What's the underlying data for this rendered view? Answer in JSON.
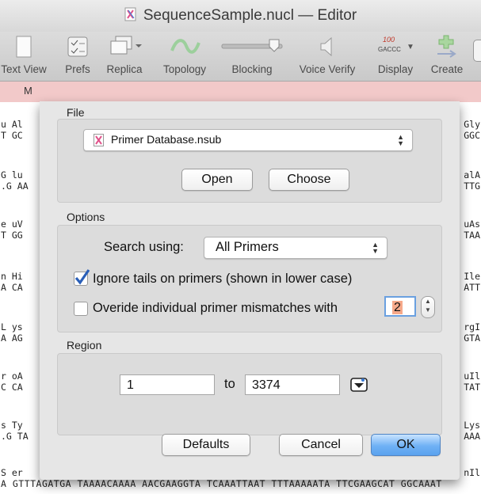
{
  "window": {
    "title": "SequenceSample.nucl — Editor"
  },
  "toolbar": {
    "items": [
      {
        "label": "Text View",
        "icon": "document-icon"
      },
      {
        "label": "Prefs",
        "icon": "checklist-icon"
      },
      {
        "label": "Replica",
        "icon": "windows-icon"
      },
      {
        "label": "Topology",
        "icon": "topology-icon"
      },
      {
        "label": "Blocking",
        "icon": "slider-icon"
      },
      {
        "label": "Voice Verify",
        "icon": "speaker-icon"
      },
      {
        "label": "Display",
        "icon": "display-icon",
        "badge_top": "100",
        "badge_bottom": "GACCC"
      },
      {
        "label": "Create",
        "icon": "create-icon"
      }
    ]
  },
  "tabstrip": {
    "first_tab": "M"
  },
  "sequence": {
    "rows": [
      {
        "left1": "u Al",
        "left2": "T GC",
        "right1": "Gly",
        "right2": "GGC"
      },
      {
        "left1": "G lu",
        "left2": ".G AA",
        "right1": "alA",
        "right2": "TTG"
      },
      {
        "left1": "e uV",
        "left2": "T GG",
        "right1": "uAs",
        "right2": "TAA"
      },
      {
        "left1": "n Hi",
        "left2": "A CA",
        "right1": "Ile",
        "right2": "ATT"
      },
      {
        "left1": "L ys",
        "left2": "A AG",
        "right1": "rgI",
        "right2": "GTA"
      },
      {
        "left1": "r oA",
        "left2": "C CA",
        "right1": "uIl",
        "right2": "TAT"
      },
      {
        "left1": "s Ty",
        "left2": ".G TA",
        "right1": "Lys",
        "right2": "AAA"
      },
      {
        "left1": "S er",
        "left2": "",
        "right1": "nIl",
        "right2": ""
      }
    ],
    "bottom_line": "A GTTTAGATGA TAAAACAAAA AACGAAGGTA TCAAATTAAT TTTAAAAATA TTCGAAGCAT GGCAAAT"
  },
  "dialog": {
    "file_section": "File",
    "file_popup": "Primer Database.nsub",
    "open_button": "Open",
    "choose_button": "Choose",
    "options_section": "Options",
    "search_label": "Search using:",
    "search_value": "All Primers",
    "ignore_tails_label": "Ignore tails on primers (shown in lower case)",
    "ignore_tails_checked": true,
    "override_label": "Overide individual primer mismatches with",
    "override_checked": false,
    "mismatch_value": "2",
    "region_section": "Region",
    "region_from": "1",
    "to_label": "to",
    "region_to": "3374",
    "defaults_button": "Defaults",
    "cancel_button": "Cancel",
    "ok_button": "OK"
  },
  "colors": {
    "accent": "#5aa2ee",
    "tabstrip": "#f2c9c9",
    "field_highlight": "#f6a98a"
  }
}
